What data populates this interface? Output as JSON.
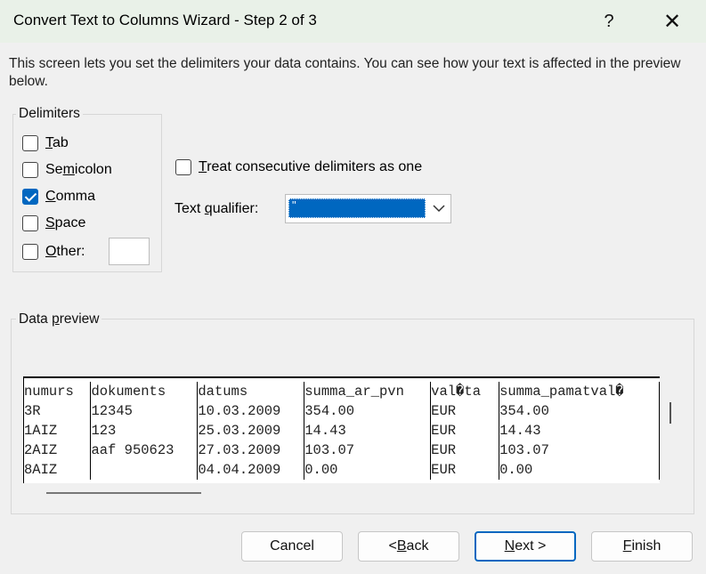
{
  "window": {
    "title": "Convert Text to Columns Wizard - Step 2 of 3",
    "help_label": "?",
    "close_label": "✕"
  },
  "intro": "This screen lets you set the delimiters your data contains.  You can see how your text is affected in the preview below.",
  "delimiters": {
    "label": "Delimiters",
    "items": [
      {
        "u": "T",
        "rest": "ab",
        "pre": "",
        "checked": false
      },
      {
        "pre": "Se",
        "u": "m",
        "rest": "icolon",
        "checked": false
      },
      {
        "pre": "",
        "u": "C",
        "rest": "omma",
        "checked": true
      },
      {
        "pre": "",
        "u": "S",
        "rest": "pace",
        "checked": false
      },
      {
        "pre": "",
        "u": "O",
        "rest": "ther:",
        "checked": false
      }
    ],
    "other_value": ""
  },
  "consecutive": {
    "u": "T",
    "rest": "reat consecutive delimiters as one",
    "checked": false
  },
  "qualifier": {
    "pre": "Text ",
    "u": "q",
    "rest": "ualifier:",
    "value": "\""
  },
  "preview": {
    "label_pre": "Data ",
    "label_u": "p",
    "label_rest": "review",
    "rows": [
      [
        "numurs",
        "dokuments",
        "datums",
        "summa_ar_pvn",
        "val�ta",
        "summa_pamatval�"
      ],
      [
        "3R",
        "12345",
        "10.03.2009",
        "354.00",
        "EUR",
        "354.00"
      ],
      [
        "1AIZ",
        "123",
        "25.03.2009",
        "14.43",
        "EUR",
        "14.43"
      ],
      [
        "2AIZ",
        "aaf 950623",
        "27.03.2009",
        "103.07",
        "EUR",
        "103.07"
      ],
      [
        "8AIZ",
        "",
        "04.04.2009",
        "0.00",
        "EUR",
        "0.00"
      ]
    ]
  },
  "buttons": {
    "cancel": "Cancel",
    "back_pre": "< ",
    "back_u": "B",
    "back_rest": "ack",
    "next_u": "N",
    "next_rest": "ext >",
    "finish_u": "F",
    "finish_rest": "inish"
  }
}
